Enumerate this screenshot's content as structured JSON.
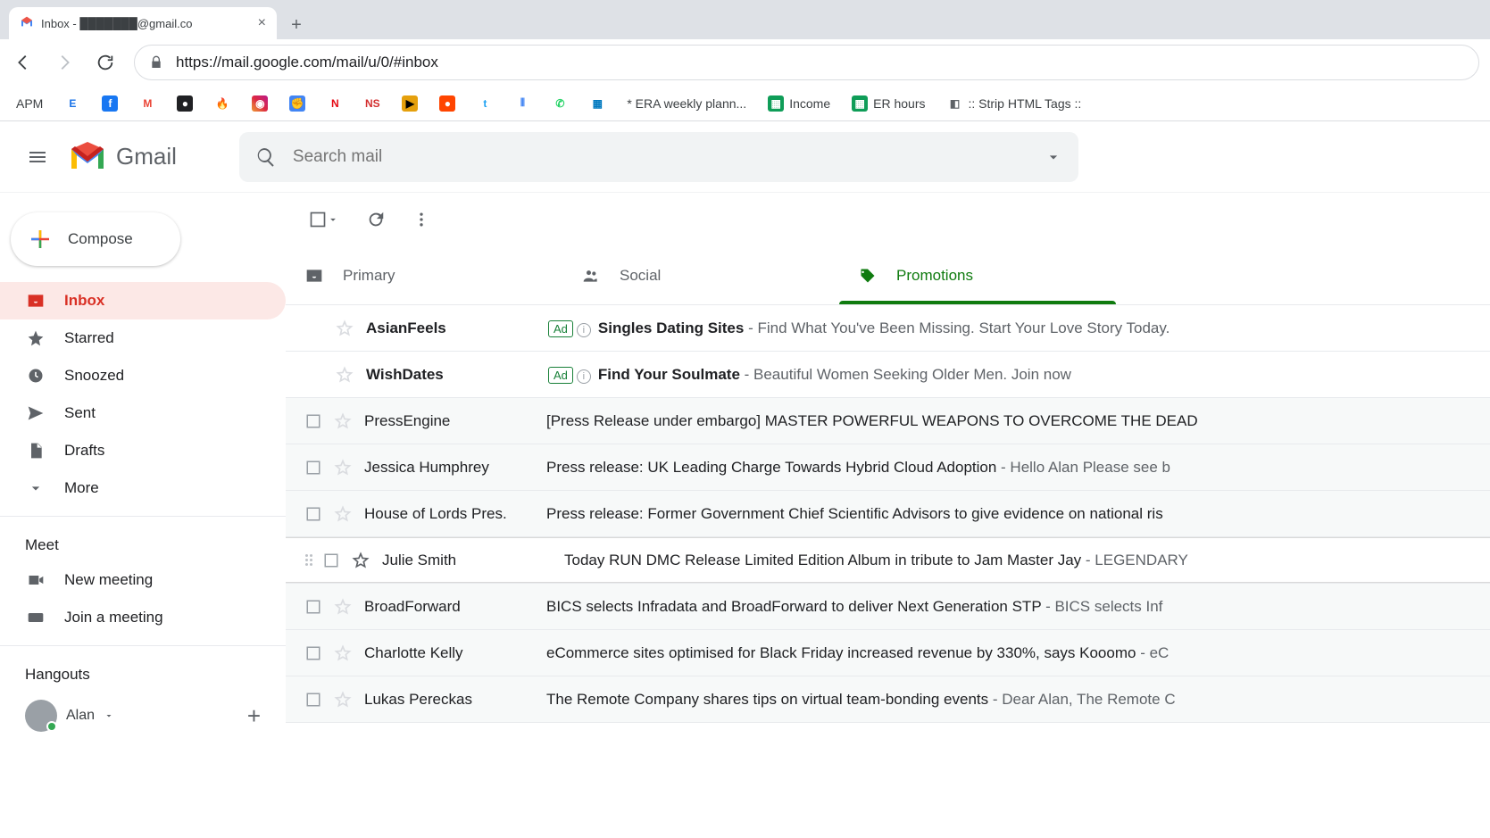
{
  "browser": {
    "tab_title": "Inbox - ███████@gmail.co",
    "url": "https://mail.google.com/mail/u/0/#inbox"
  },
  "bookmarks": [
    {
      "label": "APM",
      "text_only": true
    },
    {
      "label": "",
      "icon": "E",
      "bg": "#fff",
      "fg": "#1a73e8"
    },
    {
      "label": "",
      "icon": "f",
      "bg": "#1877f2",
      "fg": "#fff"
    },
    {
      "label": "",
      "icon": "M",
      "bg": "#fff",
      "fg": "#ea4335"
    },
    {
      "label": "",
      "icon": "●",
      "bg": "#202124",
      "fg": "#fff"
    },
    {
      "label": "",
      "icon": "🔥",
      "bg": "transparent"
    },
    {
      "label": "",
      "icon": "◉",
      "bg": "linear-gradient(45deg,#f09433,#e6683c,#dc2743,#cc2366,#bc1888)",
      "fg": "#fff"
    },
    {
      "label": "",
      "icon": "✊",
      "bg": "#4285f4",
      "fg": "#fff"
    },
    {
      "label": "",
      "icon": "N",
      "bg": "#fff",
      "fg": "#e50914"
    },
    {
      "label": "",
      "icon": "NS",
      "bg": "#fff",
      "fg": "#d32f2f"
    },
    {
      "label": "",
      "icon": "▶",
      "bg": "#e5a00d",
      "fg": "#000"
    },
    {
      "label": "",
      "icon": "●",
      "bg": "#ff4500",
      "fg": "#fff"
    },
    {
      "label": "",
      "icon": "t",
      "bg": "#fff",
      "fg": "#1da1f2"
    },
    {
      "label": "",
      "icon": "⫴",
      "bg": "#fff",
      "fg": "#4285f4"
    },
    {
      "label": "",
      "icon": "✆",
      "bg": "#fff",
      "fg": "#25d366"
    },
    {
      "label": "",
      "icon": "▦",
      "bg": "#fff",
      "fg": "#0079bf"
    },
    {
      "label": "* ERA weekly plann..."
    },
    {
      "label": "Income",
      "icon": "▦",
      "bg": "#0f9d58",
      "fg": "#fff"
    },
    {
      "label": "ER hours",
      "icon": "▦",
      "bg": "#0f9d58",
      "fg": "#fff"
    },
    {
      "label": ":: Strip HTML Tags ::",
      "icon": "◧",
      "bg": "#fff",
      "fg": "#5f6368"
    }
  ],
  "app": {
    "name": "Gmail",
    "search_placeholder": "Search mail",
    "compose_label": "Compose"
  },
  "sidebar": {
    "items": [
      {
        "label": "Inbox",
        "icon": "inbox",
        "active": true
      },
      {
        "label": "Starred",
        "icon": "star"
      },
      {
        "label": "Snoozed",
        "icon": "clock"
      },
      {
        "label": "Sent",
        "icon": "send"
      },
      {
        "label": "Drafts",
        "icon": "file"
      },
      {
        "label": "More",
        "icon": "expand"
      }
    ],
    "meet_heading": "Meet",
    "meet_items": [
      {
        "label": "New meeting",
        "icon": "video"
      },
      {
        "label": "Join a meeting",
        "icon": "keyboard"
      }
    ],
    "hangouts_heading": "Hangouts",
    "hangouts_user": "Alan"
  },
  "tabs": [
    {
      "label": "Primary",
      "icon": "inbox"
    },
    {
      "label": "Social",
      "icon": "people"
    },
    {
      "label": "Promotions",
      "icon": "tag",
      "active": true
    }
  ],
  "messages": [
    {
      "ad": true,
      "from": "AsianFeels",
      "lead": "Singles Dating Sites",
      "rest": " - Find What You've Been Missing. Start Your Love Story Today."
    },
    {
      "ad": true,
      "from": "WishDates",
      "lead": "Find Your Soulmate",
      "rest": " - Beautiful Women Seeking Older Men. Join now"
    },
    {
      "from": "PressEngine",
      "subject": "[Press Release under embargo] MASTER POWERFUL WEAPONS TO OVERCOME THE DEAD"
    },
    {
      "from": "Jessica Humphrey",
      "subject": "Press release: UK Leading Charge Towards Hybrid Cloud Adoption",
      "snippet": " - Hello Alan Please see b"
    },
    {
      "from": "House of Lords Pres.",
      "subject": "Press release: Former Government Chief Scientific Advisors to give evidence on national ris"
    },
    {
      "from": "Julie Smith",
      "subject": "Today RUN DMC Release Limited Edition Album in tribute to Jam Master Jay",
      "snippet": " - LEGENDARY",
      "hovered": true
    },
    {
      "from": "BroadForward",
      "subject": "BICS selects Infradata and BroadForward to deliver Next Generation STP",
      "snippet": " - BICS selects Inf"
    },
    {
      "from": "Charlotte Kelly",
      "subject": "eCommerce sites optimised for Black Friday increased revenue by 330%, says Kooomo",
      "snippet": " - eC"
    },
    {
      "from": "Lukas Pereckas",
      "subject": "The Remote Company shares tips on virtual team-bonding events",
      "snippet": " - Dear Alan, The Remote C"
    }
  ]
}
